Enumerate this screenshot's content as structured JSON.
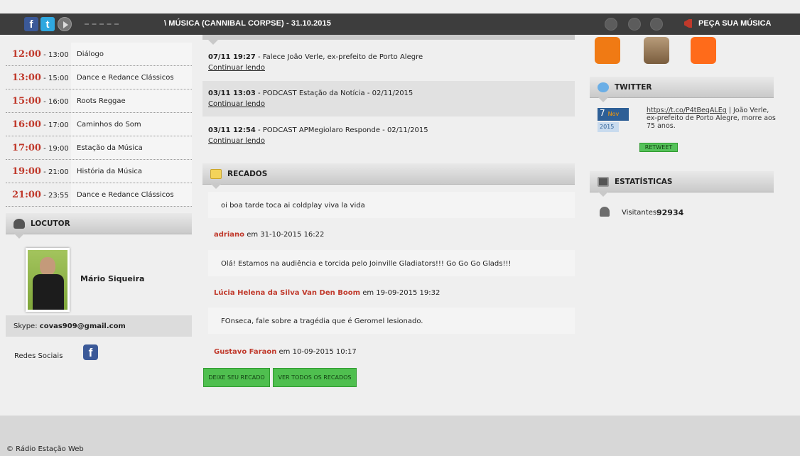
{
  "topbar": {
    "ticker": "\\ MÚSICA (CANNIBAL CORPSE) - 31.10.2015",
    "request_label": "PEÇA SUA MÚSICA"
  },
  "schedule": [
    {
      "start": "12:00",
      "end": "13:00",
      "program": "Diálogo"
    },
    {
      "start": "13:00",
      "end": "15:00",
      "program": "Dance e Redance Clássicos"
    },
    {
      "start": "15:00",
      "end": "16:00",
      "program": "Roots Reggae"
    },
    {
      "start": "16:00",
      "end": "17:00",
      "program": "Caminhos do Som"
    },
    {
      "start": "17:00",
      "end": "19:00",
      "program": "Estação da Música"
    },
    {
      "start": "19:00",
      "end": "21:00",
      "program": "História da Música"
    },
    {
      "start": "21:00",
      "end": "23:55",
      "program": "Dance e Redance Clássicos"
    }
  ],
  "locutor": {
    "title": "LOCUTOR",
    "name": "Mário Siqueira",
    "skype_label": "Skype:",
    "skype_value": "covas909@gmail.com",
    "social_label": "Redes Sociais"
  },
  "news": [
    {
      "datetime": "07/11 19:27",
      "title": "Falece João Verle, ex-prefeito de Porto Alegre",
      "link": "Continuar lendo"
    },
    {
      "datetime": "03/11 13:03",
      "title": "PODCAST Estação da Notícia - 02/11/2015",
      "link": "Continuar lendo"
    },
    {
      "datetime": "03/11 12:54",
      "title": "PODCAST APMegiolaro Responde - 02/11/2015",
      "link": "Continuar lendo"
    }
  ],
  "recados": {
    "title": "RECADOS",
    "messages": [
      {
        "text": "oi boa tarde toca ai coldplay viva la vida",
        "author": "adriano",
        "date": "em 31-10-2015 16:22"
      },
      {
        "text": "Olá! Estamos na audiência e torcida pelo Joinville Gladiators!!! Go Go Go Glads!!!",
        "author": "Lúcia Helena da Silva Van Den Boom",
        "date": "em 19-09-2015 19:32"
      },
      {
        "text": "FOnseca, fale sobre a tragédia que é Geromel lesionado.",
        "author": "Gustavo Faraon",
        "date": "em 10-09-2015 10:17"
      }
    ],
    "leave_button": "DEIXE SEU RECADO",
    "all_button": "VER TODOS OS RECADOS"
  },
  "twitter": {
    "title": "TWITTER",
    "day": "7",
    "month": "Nov",
    "year": "2015",
    "link": "https://t.co/P4tBeqALEg",
    "text": " | João Verle, ex-prefeito de Porto Alegre, morre aos 75 anos.",
    "retweet": "RETWEET"
  },
  "stats": {
    "title": "ESTATÍSTICAS",
    "visitors_label": "Visitantes:",
    "visitors_value": "92934"
  },
  "footer": {
    "copyright": "© Rádio Estação Web"
  },
  "colors": {
    "accent_red": "#c0392b",
    "button_green": "#4fbf4f",
    "topbar": "#3d3d3d"
  }
}
